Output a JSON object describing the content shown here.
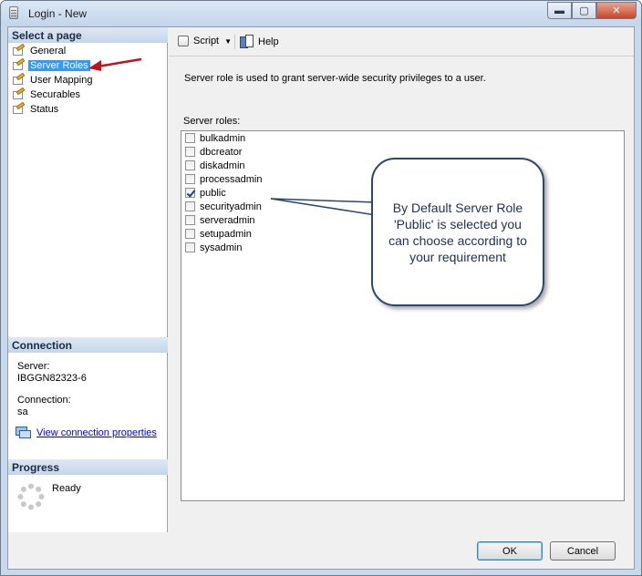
{
  "window": {
    "title": "Login - New",
    "minimize": "▬",
    "maximize": "▢",
    "close": "✕"
  },
  "select_page": {
    "header": "Select a page",
    "items": [
      {
        "label": "General",
        "icon": "page-wrench-icon"
      },
      {
        "label": "Server Roles",
        "icon": "page-wrench-icon",
        "selected": true
      },
      {
        "label": "User Mapping",
        "icon": "page-wrench-icon"
      },
      {
        "label": "Securables",
        "icon": "page-wrench-icon"
      },
      {
        "label": "Status",
        "icon": "page-wrench-icon"
      }
    ]
  },
  "connection": {
    "header": "Connection",
    "server_label": "Server:",
    "server_value": "IBGGN82323-6",
    "connection_label": "Connection:",
    "connection_value": "sa",
    "link": "View connection properties"
  },
  "progress": {
    "header": "Progress",
    "status": "Ready"
  },
  "toolbar": {
    "script": "Script",
    "help": "Help"
  },
  "main": {
    "description": "Server role is used to grant server-wide security privileges to a user.",
    "roles_label": "Server roles:",
    "roles": [
      {
        "name": "bulkadmin",
        "checked": false
      },
      {
        "name": "dbcreator",
        "checked": false
      },
      {
        "name": "diskadmin",
        "checked": false
      },
      {
        "name": "processadmin",
        "checked": false
      },
      {
        "name": "public",
        "checked": true
      },
      {
        "name": "securityadmin",
        "checked": false
      },
      {
        "name": "serveradmin",
        "checked": false
      },
      {
        "name": "setupadmin",
        "checked": false
      },
      {
        "name": "sysadmin",
        "checked": false
      }
    ]
  },
  "callout": {
    "text": "By Default Server Role 'Public' is selected you can choose according to your requirement"
  },
  "buttons": {
    "ok": "OK",
    "cancel": "Cancel"
  },
  "colors": {
    "selection": "#3399ff",
    "annotation_arrow": "#c0131b",
    "callout_border": "#2b4670"
  }
}
